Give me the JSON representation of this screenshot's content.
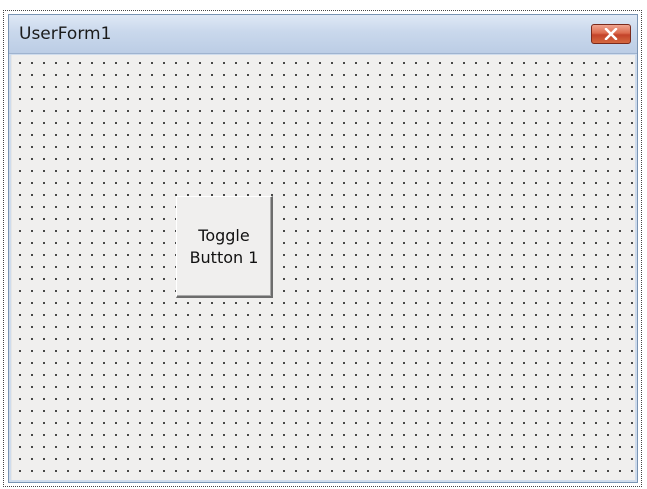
{
  "window": {
    "title": "UserForm1",
    "close_icon": "close-icon"
  },
  "controls": {
    "toggle_button": {
      "label": "Toggle Button 1"
    }
  },
  "colors": {
    "titlebar": "#c9d8ec",
    "close_button": "#dc6b4e",
    "form_background": "#f0efee",
    "grid_dots": "#1e1e1e"
  }
}
